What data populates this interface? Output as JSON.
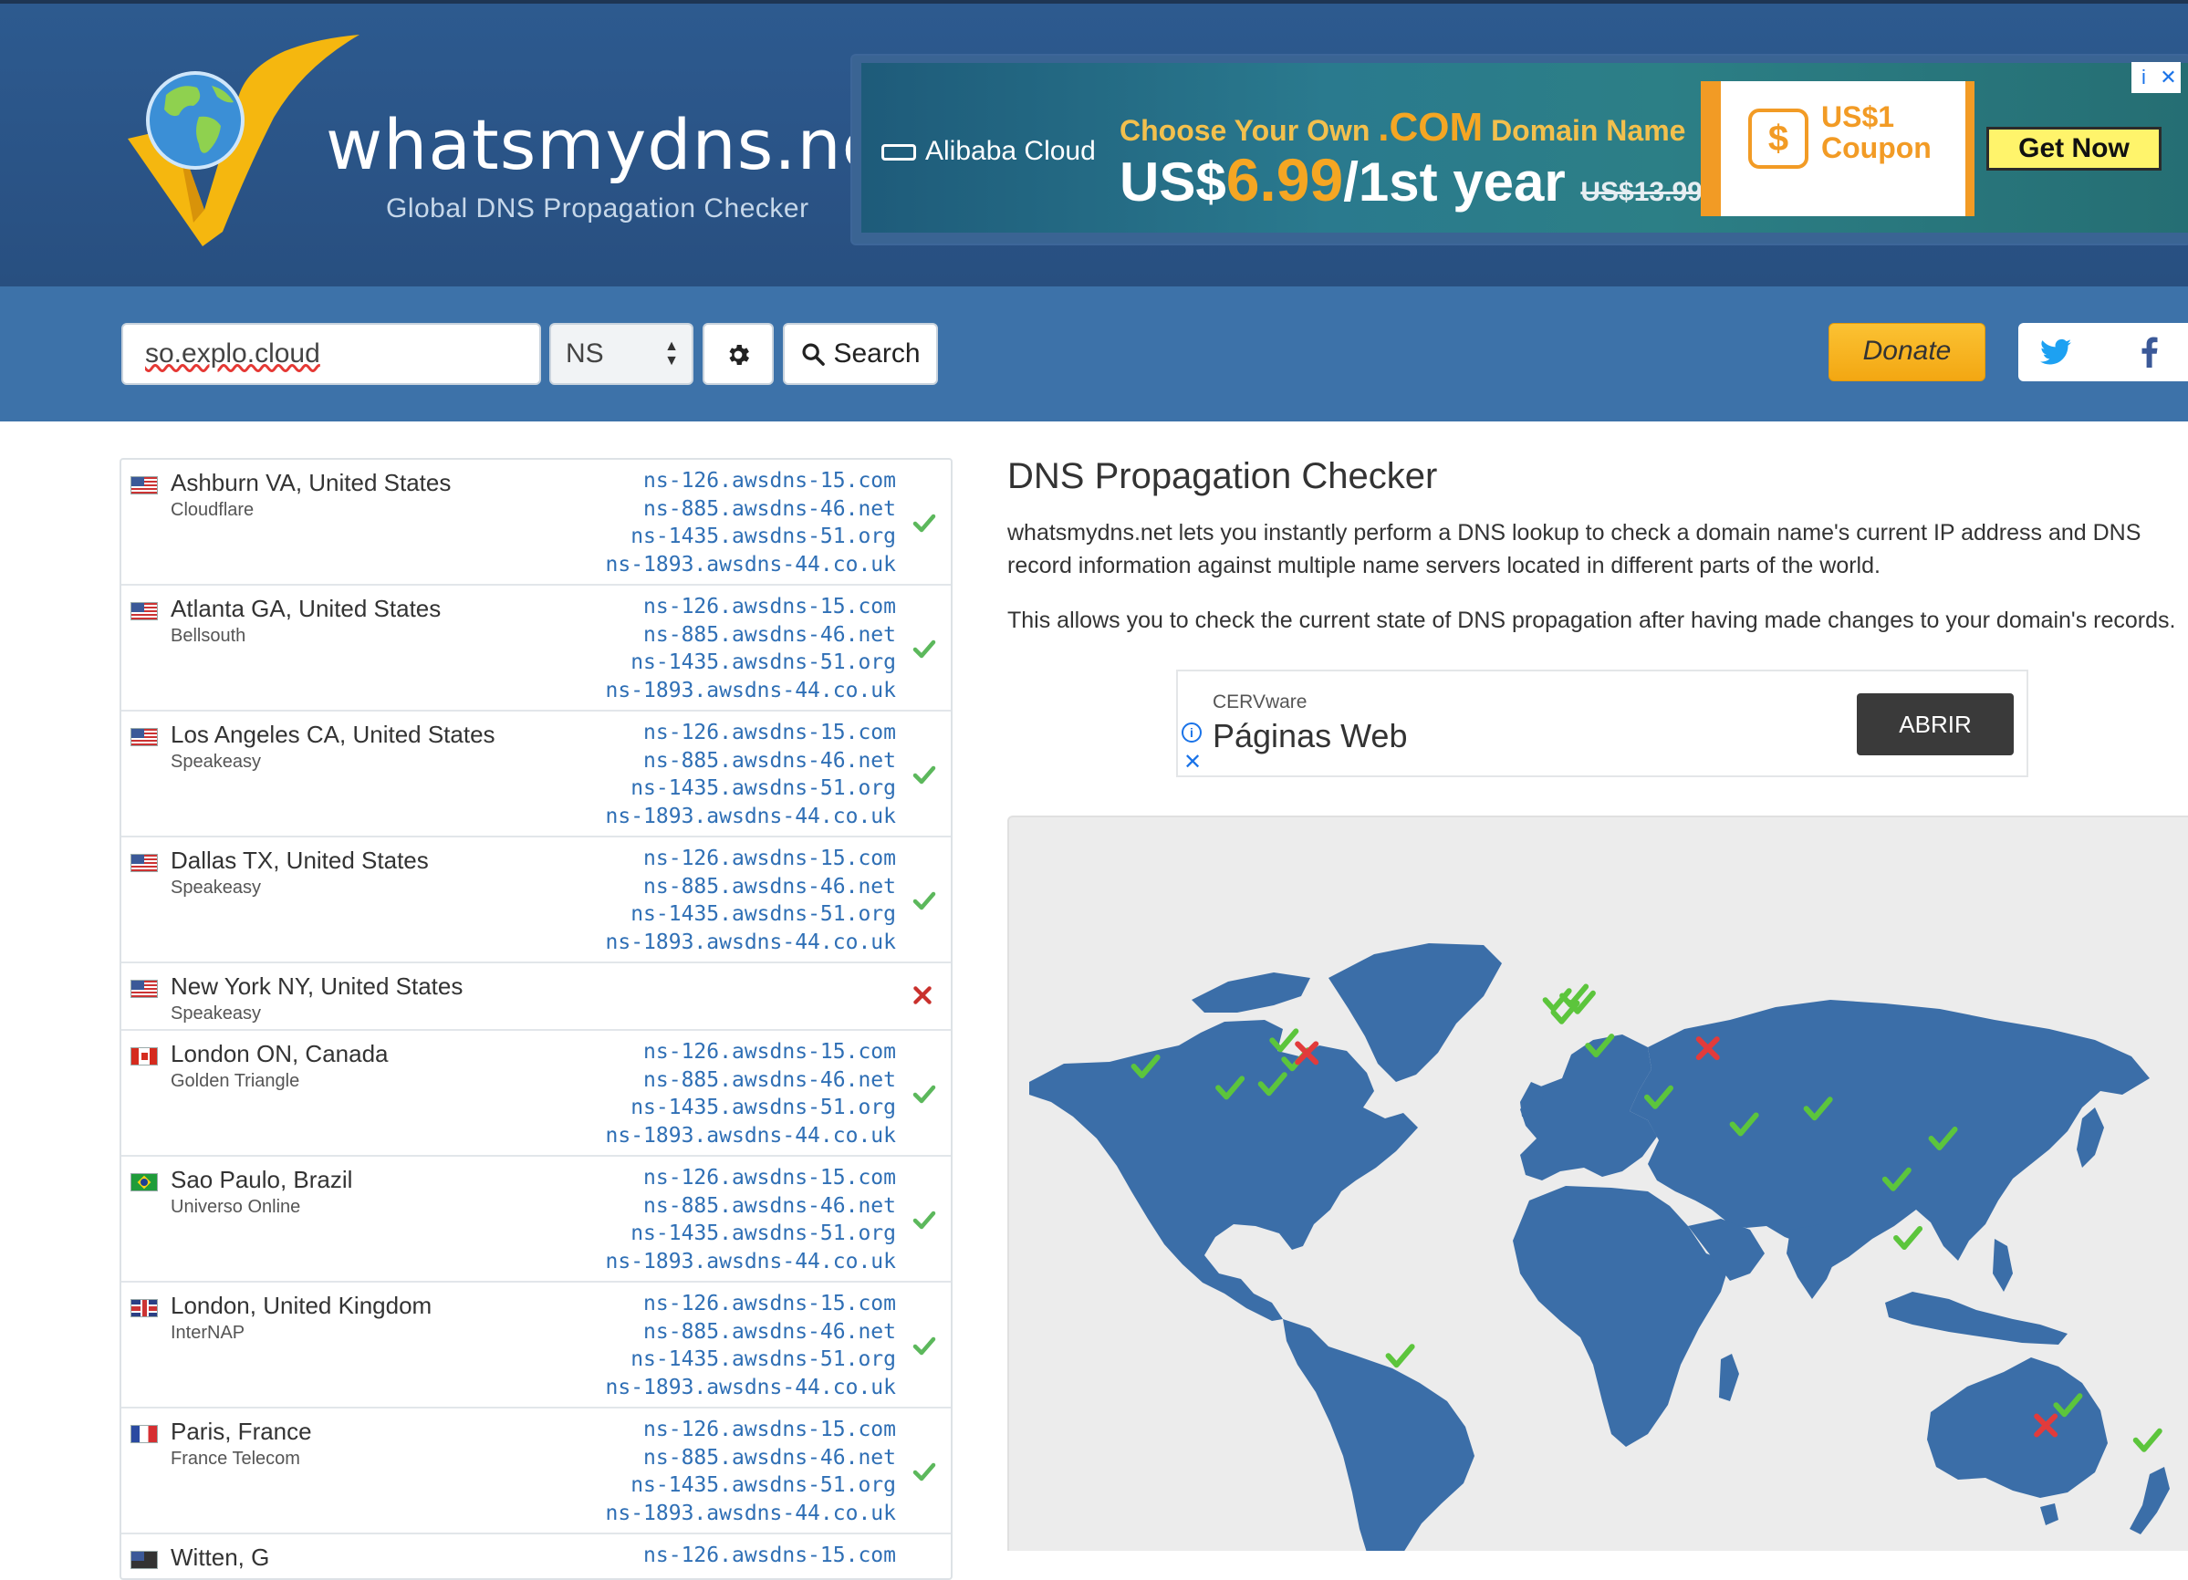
{
  "header": {
    "logo_title": "whatsmydns.net",
    "logo_tagline": "Global DNS Propagation Checker",
    "colors": {
      "bg": "#2c5282",
      "logo_check": "#f5b70f",
      "globe": "#3b8fd6"
    }
  },
  "top_ad": {
    "brand": "Alibaba Cloud",
    "line1_prefix": "Choose Your Own ",
    "line1_com": ".COM",
    "line1_suffix": " Domain Name",
    "price_prefix": "US$",
    "price_big": "6.99",
    "price_suffix": "/1st year",
    "price_old": "US$13.99",
    "coupon_line1": "US$1",
    "coupon_line2": "Coupon",
    "cta": "Get Now",
    "choices_info": "i",
    "choices_close": "✕"
  },
  "search": {
    "domain_value": "so.explo.cloud",
    "record_type": "NS",
    "search_label": "Search",
    "donate_label": "Donate",
    "icons": {
      "settings": "gear-icon",
      "search": "magnifier-icon",
      "twitter": "twitter-icon",
      "facebook": "facebook-icon"
    }
  },
  "results": [
    {
      "location": "Ashburn VA, United States",
      "provider": "Cloudflare",
      "flag": "us",
      "status": "ok",
      "ns": [
        "ns-126.awsdns-15.com",
        "ns-885.awsdns-46.net",
        "ns-1435.awsdns-51.org",
        "ns-1893.awsdns-44.co.uk"
      ]
    },
    {
      "location": "Atlanta GA, United States",
      "provider": "Bellsouth",
      "flag": "us",
      "status": "ok",
      "ns": [
        "ns-126.awsdns-15.com",
        "ns-885.awsdns-46.net",
        "ns-1435.awsdns-51.org",
        "ns-1893.awsdns-44.co.uk"
      ]
    },
    {
      "location": "Los Angeles CA, United States",
      "provider": "Speakeasy",
      "flag": "us",
      "status": "ok",
      "ns": [
        "ns-126.awsdns-15.com",
        "ns-885.awsdns-46.net",
        "ns-1435.awsdns-51.org",
        "ns-1893.awsdns-44.co.uk"
      ]
    },
    {
      "location": "Dallas TX, United States",
      "provider": "Speakeasy",
      "flag": "us",
      "status": "ok",
      "ns": [
        "ns-126.awsdns-15.com",
        "ns-885.awsdns-46.net",
        "ns-1435.awsdns-51.org",
        "ns-1893.awsdns-44.co.uk"
      ]
    },
    {
      "location": "New York NY, United States",
      "provider": "Speakeasy",
      "flag": "us",
      "status": "fail",
      "ns": []
    },
    {
      "location": "London ON, Canada",
      "provider": "Golden Triangle",
      "flag": "ca",
      "status": "ok",
      "ns": [
        "ns-126.awsdns-15.com",
        "ns-885.awsdns-46.net",
        "ns-1435.awsdns-51.org",
        "ns-1893.awsdns-44.co.uk"
      ]
    },
    {
      "location": "Sao Paulo, Brazil",
      "provider": "Universo Online",
      "flag": "br",
      "status": "ok",
      "ns": [
        "ns-126.awsdns-15.com",
        "ns-885.awsdns-46.net",
        "ns-1435.awsdns-51.org",
        "ns-1893.awsdns-44.co.uk"
      ]
    },
    {
      "location": "London, United Kingdom",
      "provider": "InterNAP",
      "flag": "uk",
      "status": "ok",
      "ns": [
        "ns-126.awsdns-15.com",
        "ns-885.awsdns-46.net",
        "ns-1435.awsdns-51.org",
        "ns-1893.awsdns-44.co.uk"
      ]
    },
    {
      "location": "Paris, France",
      "provider": "France Telecom",
      "flag": "fr",
      "status": "ok",
      "ns": [
        "ns-126.awsdns-15.com",
        "ns-885.awsdns-46.net",
        "ns-1435.awsdns-51.org",
        "ns-1893.awsdns-44.co.uk"
      ]
    }
  ],
  "partial_row": {
    "location": "Witten, G",
    "ns": "ns-126.awsdns-15.com"
  },
  "content": {
    "title": "DNS Propagation Checker",
    "intro1": "whatsmydns.net lets you instantly perform a DNS lookup to check a domain name's current IP address and DNS record information against multiple name servers located in different parts of the world.",
    "intro2": "This allows you to check the current state of DNS propagation after having made changes to your domain's records."
  },
  "inline_ad": {
    "sponsor": "CERVware",
    "headline": "Páginas Web",
    "cta": "ABRIR",
    "info_icon": "i",
    "close_icon": "✕"
  },
  "map": {
    "land_color": "#3b6ea8",
    "ocean_color": "#ececec",
    "ok_color": "#5cc53c",
    "fail_color": "#e23b3b",
    "markers": [
      {
        "lon": -122,
        "lat": 37.5,
        "status": "ok"
      },
      {
        "lon": -97,
        "lat": 33,
        "status": "ok"
      },
      {
        "lon": -84.4,
        "lat": 33.8,
        "status": "ok"
      },
      {
        "lon": -77.5,
        "lat": 39,
        "status": "ok"
      },
      {
        "lon": -81,
        "lat": 43,
        "status": "ok"
      },
      {
        "lon": -74,
        "lat": 40.7,
        "status": "fail"
      },
      {
        "lon": -46.6,
        "lat": -23.5,
        "status": "ok"
      },
      {
        "lon": -0.1,
        "lat": 51.5,
        "status": "ok"
      },
      {
        "lon": 2.3,
        "lat": 48.9,
        "status": "ok"
      },
      {
        "lon": 7,
        "lat": 51,
        "status": "ok"
      },
      {
        "lon": 4.9,
        "lat": 52.4,
        "status": "ok"
      },
      {
        "lon": 12.5,
        "lat": 41.9,
        "status": "ok"
      },
      {
        "lon": 30,
        "lat": 31,
        "status": "ok"
      },
      {
        "lon": 44.8,
        "lat": 41.7,
        "status": "fail"
      },
      {
        "lon": 55.3,
        "lat": 25.3,
        "status": "ok"
      },
      {
        "lon": 77.2,
        "lat": 28.6,
        "status": "ok"
      },
      {
        "lon": 100.5,
        "lat": 13.7,
        "status": "ok"
      },
      {
        "lon": 103.8,
        "lat": 1.35,
        "status": "ok"
      },
      {
        "lon": 114.2,
        "lat": 22.3,
        "status": "ok"
      },
      {
        "lon": 144.9,
        "lat": -37.8,
        "status": "fail"
      },
      {
        "lon": 151.2,
        "lat": -33.9,
        "status": "ok"
      },
      {
        "lon": 174.8,
        "lat": -41.3,
        "status": "ok"
      }
    ]
  }
}
